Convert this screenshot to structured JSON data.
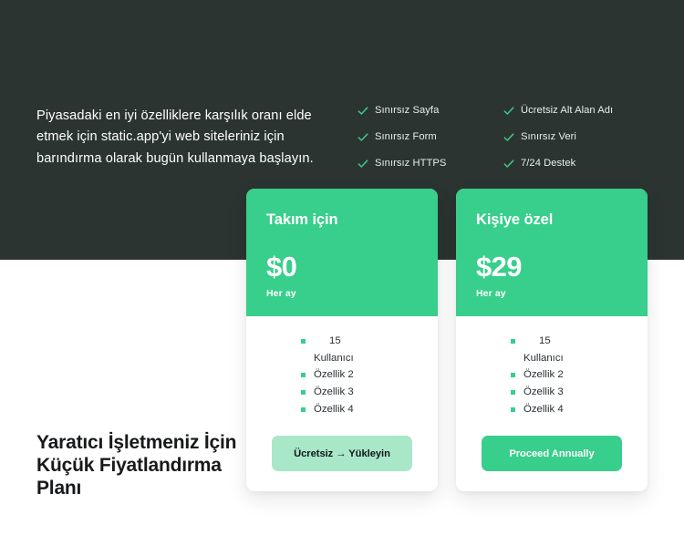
{
  "hero": {
    "intro": "Piyasadaki en iyi özelliklere karşılık oranı elde etmek için static.app'yi web siteleriniz için barındırma olarak bugün kullanmaya başlayın.",
    "feature_columns": [
      {
        "items": [
          "Sınırsız Sayfa",
          "Sınırsız Form",
          "Sınırsız HTTPS"
        ]
      },
      {
        "items": [
          "Ücretsiz Alt Alan Adı",
          "Sınırsız Veri",
          "7/24 Destek"
        ]
      }
    ]
  },
  "bottom_heading": "Yaratıcı İşletmeniz İçin Küçük Fiyatlandırma Planı",
  "plans": [
    {
      "name": "Takım için",
      "price": "$0",
      "period": "Her ay",
      "features": [
        "15",
        "Kullanıcı",
        "Özellik 2",
        "Özellik 3",
        "Özellik 4"
      ],
      "cta_label": "Ücretsiz → Yükleyin"
    },
    {
      "name": "Kişiye özel",
      "price": "$29",
      "period": "Her ay",
      "features": [
        "15",
        "Kullanıcı",
        "Özellik 2",
        "Özellik 3",
        "Özellik 4"
      ],
      "cta_label": "Proceed Annually"
    }
  ],
  "colors": {
    "dark_band": "#2b3430",
    "accent_green": "#38ce8b",
    "accent_green_light": "#a9e7c9",
    "page_background": "#ffffff",
    "heading_text": "#17191b"
  }
}
